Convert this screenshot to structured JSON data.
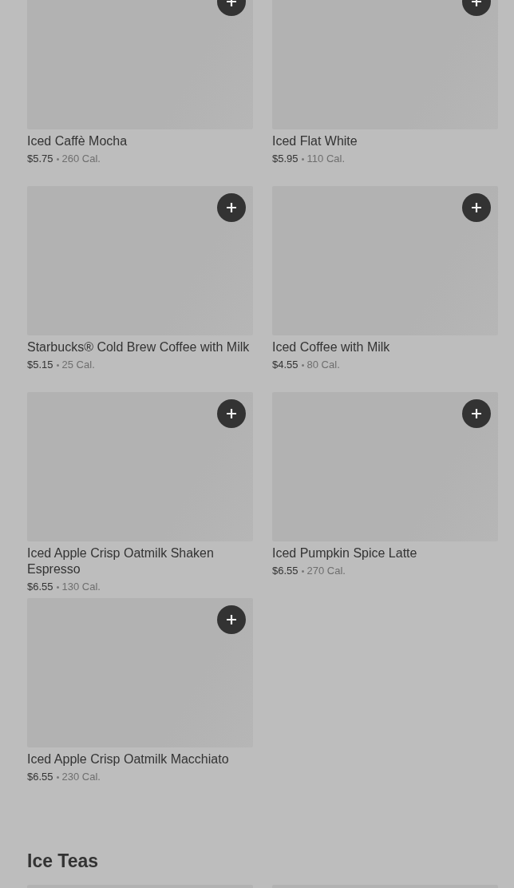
{
  "sections": [
    {
      "items": [
        {
          "kind": "product",
          "name": "Iced Caffè Mocha",
          "price": "$5.75",
          "calories": "260 Cal."
        },
        {
          "kind": "product",
          "name": "Iced Flat White",
          "price": "$5.95",
          "calories": "110 Cal."
        },
        {
          "kind": "product",
          "name": "Starbucks® Cold Brew Coffee with Milk",
          "price": "$5.15",
          "calories": "25 Cal."
        },
        {
          "kind": "product",
          "name": "Iced Coffee with Milk",
          "price": "$4.55",
          "calories": "80 Cal."
        },
        {
          "kind": "product",
          "name": "Iced Apple Crisp Oatmilk Shaken Espresso",
          "price": "$6.55",
          "calories": "130 Cal."
        },
        {
          "kind": "product",
          "name": "Iced Pumpkin Spice Latte",
          "price": "$6.55",
          "calories": "270 Cal."
        },
        {
          "kind": "product",
          "name": "Iced Apple Crisp Oatmilk Macchiato",
          "price": "$6.55",
          "calories": "230 Cal."
        }
      ]
    },
    {
      "heading": "Ice Teas",
      "items": [
        {
          "kind": "image_only"
        },
        {
          "kind": "image_only"
        }
      ]
    }
  ]
}
